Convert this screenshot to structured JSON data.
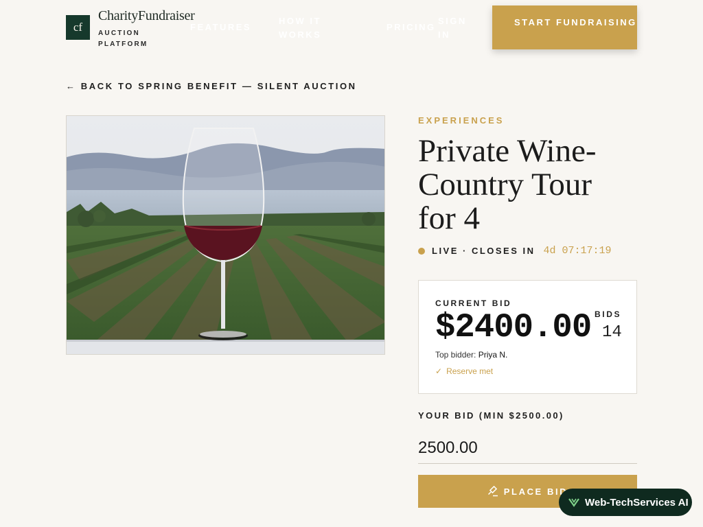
{
  "header": {
    "logo_mark": "cf",
    "brand_name": "CharityFundraiser",
    "brand_sub": "AUCTION PLATFORM",
    "nav": {
      "features": "FEATURES",
      "how_it_works": "HOW IT WORKS",
      "pricing": "PRICING",
      "sign_in": "SIGN IN"
    },
    "cta": "START FUNDRAISING"
  },
  "back_link": "← BACK TO SPRING BENEFIT — SILENT AUCTION",
  "item": {
    "image_icon": "wine-glass-vineyard-photo",
    "category": "EXPERIENCES",
    "title": "Private Wine-Country Tour for 4",
    "status": "LIVE · CLOSES IN",
    "countdown": "4d 07:17:19"
  },
  "bid_card": {
    "label": "CURRENT BID",
    "amount": "$2400.00",
    "bids_label": "BIDS",
    "bids_count": "14",
    "top_bidder_label": "Top bidder:",
    "top_bidder_name": "Priya N.",
    "reserve_icon": "check-icon",
    "reserve": "Reserve met"
  },
  "bid_form": {
    "label": "YOUR BID (MIN $2500.00)",
    "value": "2500.00",
    "button": "PLACE BID",
    "button_icon": "gavel-icon"
  },
  "badge": {
    "label": "Web-TechServices AI"
  },
  "colors": {
    "accent": "#c9a14d",
    "brand_dark": "#16392c",
    "background": "#f8f6f2"
  }
}
